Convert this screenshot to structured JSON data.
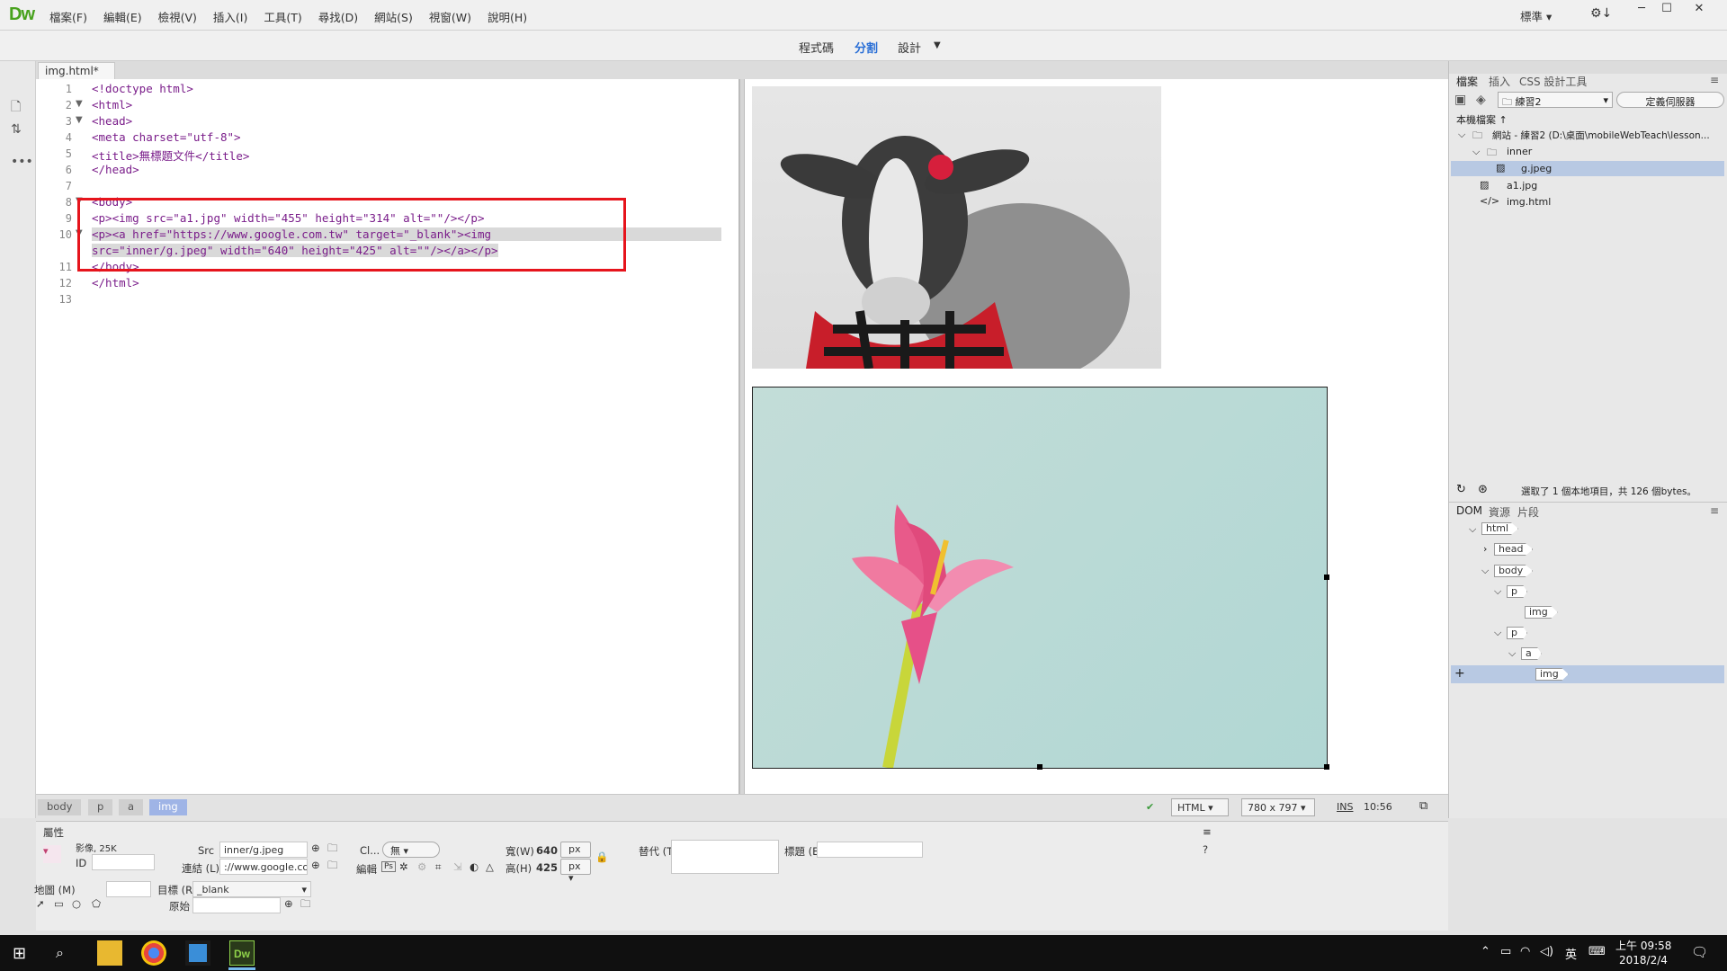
{
  "app": {
    "logo": "Dw"
  },
  "menu": [
    "檔案(F)",
    "編輯(E)",
    "檢視(V)",
    "插入(I)",
    "工具(T)",
    "尋找(D)",
    "網站(S)",
    "視窗(W)",
    "說明(H)"
  ],
  "workspace": "標準",
  "viewbar": {
    "code": "程式碼",
    "split": "分割",
    "design": "設計"
  },
  "doc_tab": "img.html*",
  "code_lines": [
    {
      "n": "1",
      "t": "<!doctype html>"
    },
    {
      "n": "2",
      "t": "<html>"
    },
    {
      "n": "3",
      "t": "<head>"
    },
    {
      "n": "4",
      "t": "<meta charset=\"utf-8\">"
    },
    {
      "n": "5",
      "t": "<title>無標題文件</title>"
    },
    {
      "n": "6",
      "t": "</head>"
    },
    {
      "n": "7",
      "t": ""
    },
    {
      "n": "8",
      "t": "<body>"
    },
    {
      "n": "9",
      "t": "<p><img src=\"a1.jpg\" width=\"455\" height=\"314\" alt=\"\"/></p>"
    },
    {
      "n": "10",
      "t": "<p><a href=\"https://www.google.com.tw\" target=\"_blank\"><img"
    },
    {
      "n": "",
      "t": "src=\"inner/g.jpeg\" width=\"640\" height=\"425\" alt=\"\"/></a></p>"
    },
    {
      "n": "11",
      "t": "</body>"
    },
    {
      "n": "12",
      "t": "</html>"
    },
    {
      "n": "13",
      "t": ""
    }
  ],
  "status": {
    "crumbs": [
      "body",
      "p",
      "a",
      "img"
    ],
    "language": "HTML",
    "size": "780 x 797",
    "mode": "INS",
    "position": "10:56"
  },
  "props": {
    "title": "屬性",
    "image_label": "影像, 25K",
    "id_label": "ID",
    "src_label": "Src",
    "src_value": "inner/g.jpeg",
    "link_label": "連結 (L)",
    "link_value": "://www.google.com.tw",
    "class_label": "Cl...",
    "class_value": "無",
    "edit_label": "編輯",
    "width_label": "寬(W)",
    "width_value": "640",
    "height_label": "高(H)",
    "height_value": "425",
    "unit": "px",
    "alt_label": "替代 (T)",
    "title_label": "標題 (E)",
    "map_label": "地圖 (M)",
    "target_label": "目標 (R)",
    "target_value": "_blank",
    "original_label": "原始"
  },
  "files_panel": {
    "tabs": [
      "檔案",
      "插入",
      "CSS 設計工具"
    ],
    "site": "練習2",
    "define_server": "定義伺服器",
    "local_files": "本機檔案 ↑",
    "site_root": "網站 - 練習2 (D:\\桌面\\mobileWebTeach\\lesson...",
    "items": [
      "inner",
      "g.jpeg",
      "a1.jpg",
      "img.html"
    ],
    "status": "選取了 1 個本地項目，共 126 個bytes。"
  },
  "dom_panel": {
    "tabs": [
      "DOM",
      "資源",
      "片段"
    ],
    "nodes": [
      "html",
      "head",
      "body",
      "p",
      "img",
      "p",
      "a",
      "img"
    ]
  },
  "taskbar": {
    "time": "上午 09:58",
    "date": "2018/2/4",
    "ime": "英"
  }
}
